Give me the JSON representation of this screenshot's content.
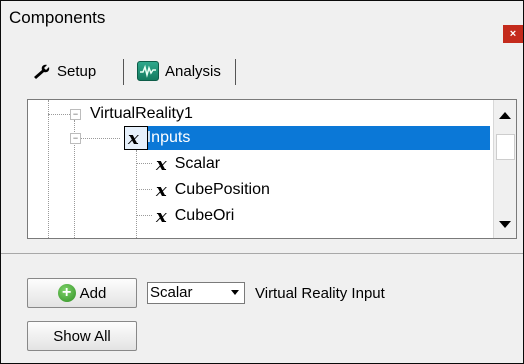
{
  "window": {
    "title": "Components",
    "close_label": "×"
  },
  "tabs": [
    {
      "label": "Setup",
      "icon": "wrench-icon"
    },
    {
      "label": "Analysis",
      "icon": "analysis-chart-icon"
    }
  ],
  "tree": {
    "nodes": [
      {
        "label": "VirtualReality1",
        "icon": "none",
        "expander": "minus"
      },
      {
        "label": "Inputs",
        "icon": "x-variable-icon",
        "expander": "minus",
        "selected": true
      },
      {
        "label": "Scalar",
        "icon": "x-variable-icon"
      },
      {
        "label": "CubePosition",
        "icon": "x-variable-icon"
      },
      {
        "label": "CubeOri",
        "icon": "x-variable-icon"
      }
    ],
    "icon_glyph": "x"
  },
  "controls": {
    "add_label": "Add",
    "show_all_label": "Show All",
    "input_type_value": "Scalar",
    "input_description": "Virtual Reality Input"
  },
  "colors": {
    "selection": "#0b78d7",
    "close": "#c42b1c"
  }
}
